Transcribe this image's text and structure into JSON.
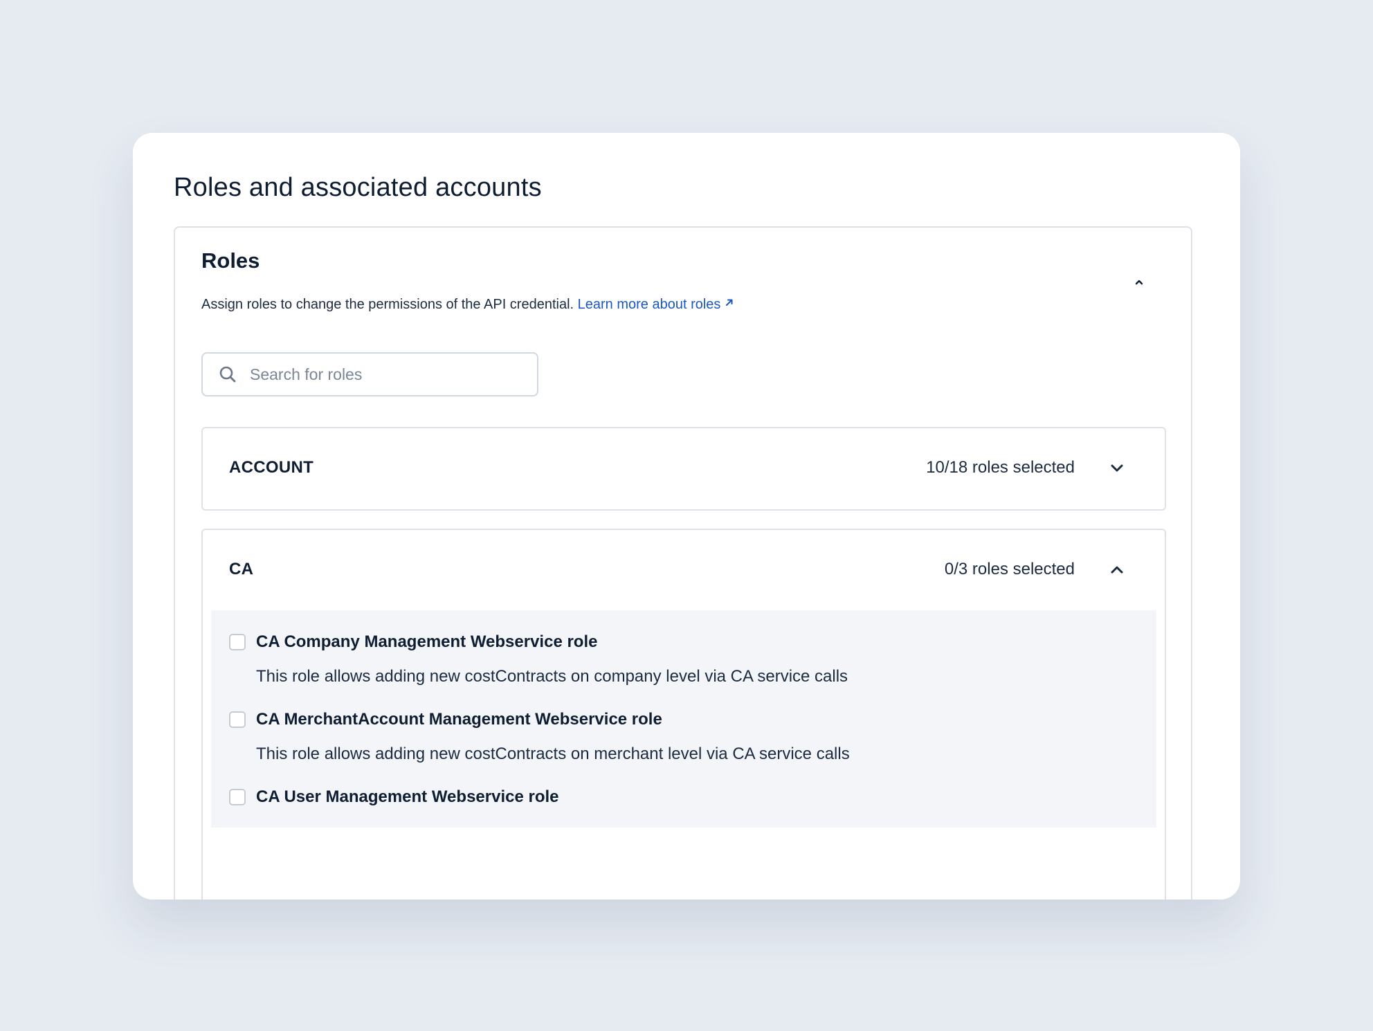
{
  "page": {
    "title": "Roles and associated accounts"
  },
  "roles_panel": {
    "title": "Roles",
    "description": "Assign roles to change the permissions of the API credential.",
    "learn_more_label": "Learn more about roles",
    "collapse_icon": "chevron-up-icon"
  },
  "search": {
    "placeholder": "Search for roles",
    "value": "",
    "icon": "search-icon"
  },
  "groups": [
    {
      "name": "ACCOUNT",
      "count_label": "10/18 roles selected",
      "expanded": false,
      "icon": "chevron-down-icon"
    },
    {
      "name": "CA",
      "count_label": "0/3 roles selected",
      "expanded": true,
      "icon": "chevron-up-icon",
      "roles": [
        {
          "name": "CA Company Management Webservice role",
          "description": "This role allows adding new costContracts on company level via CA service calls",
          "checked": false
        },
        {
          "name": "CA MerchantAccount Management Webservice role",
          "description": "This role allows adding new costContracts on merchant level via CA service calls",
          "checked": false
        },
        {
          "name": "CA User Management Webservice role",
          "description": "",
          "checked": false
        }
      ]
    }
  ],
  "colors": {
    "background": "#e6ebf2",
    "card": "#ffffff",
    "text": "#0f1d33",
    "link": "#1a56c4",
    "border": "#dde2e9",
    "roles_background": "#f3f5f8"
  }
}
